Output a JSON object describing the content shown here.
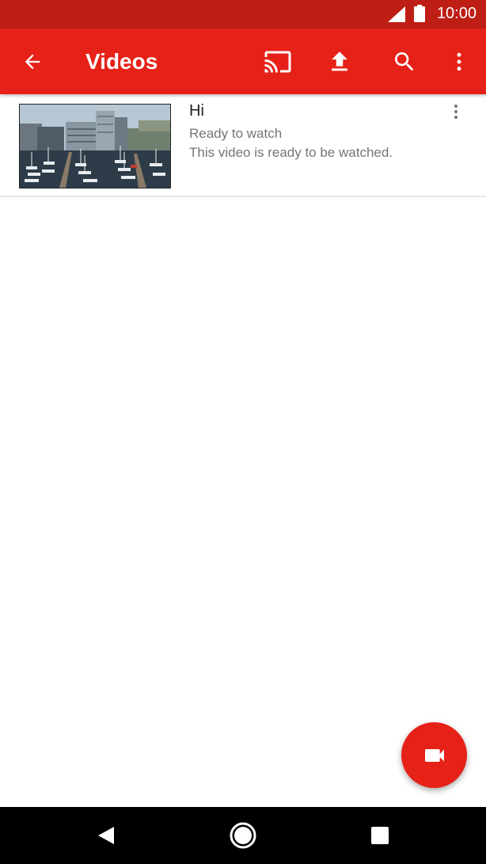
{
  "status_bar": {
    "time": "10:00",
    "icons": [
      "signal-icon",
      "battery-icon"
    ]
  },
  "app_bar": {
    "title": "Videos",
    "actions": [
      "back-arrow-icon",
      "cast-icon",
      "upload-icon",
      "search-icon",
      "more-vert-icon"
    ]
  },
  "videos": [
    {
      "title": "Hi",
      "status": "Ready to watch",
      "description": "This video is ready to be watched.",
      "thumbnail": "marina-harbor-thumbnail"
    }
  ],
  "fab": {
    "icon": "videocam-icon"
  },
  "nav_bar": {
    "buttons": [
      "nav-back-icon",
      "nav-home-icon",
      "nav-recents-icon"
    ]
  },
  "colors": {
    "status_bar": "#be1e15",
    "app_bar": "#e62117",
    "fab": "#e62117",
    "divider": "#e6e6e6",
    "secondary_text": "#757575"
  }
}
